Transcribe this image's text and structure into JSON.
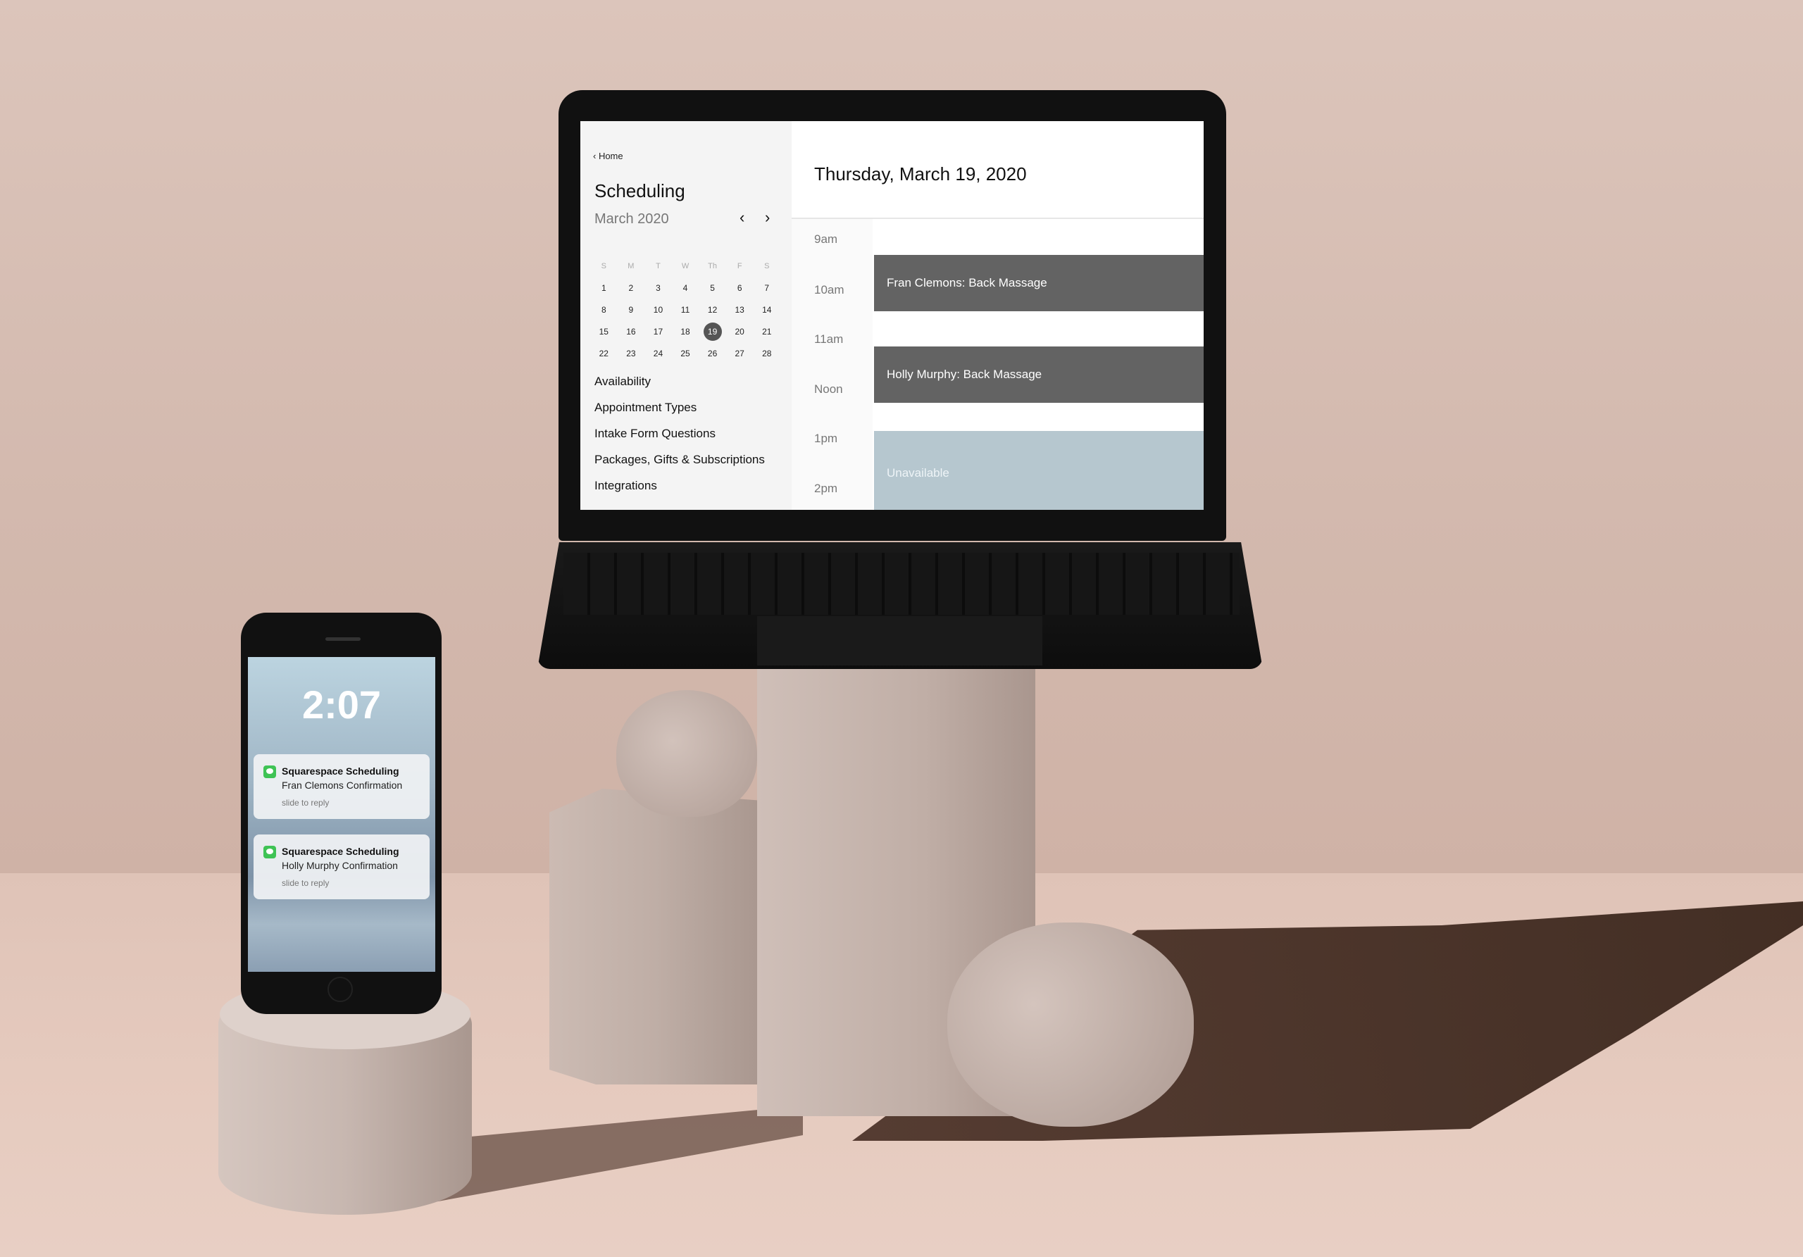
{
  "sidebar": {
    "home_link": "‹ Home",
    "title": "Scheduling",
    "month": "March 2020",
    "prev": "‹",
    "next": "›",
    "weekdays": [
      "S",
      "M",
      "T",
      "W",
      "Th",
      "F",
      "S"
    ],
    "weeks": [
      [
        "1",
        "2",
        "3",
        "4",
        "5",
        "6",
        "7"
      ],
      [
        "8",
        "9",
        "10",
        "11",
        "12",
        "13",
        "14"
      ],
      [
        "15",
        "16",
        "17",
        "18",
        "19",
        "20",
        "21"
      ],
      [
        "22",
        "23",
        "24",
        "25",
        "26",
        "27",
        "28"
      ]
    ],
    "selected_day": "19",
    "menu": [
      "Availability",
      "Appointment Types",
      "Intake Form Questions",
      "Packages, Gifts & Subscriptions",
      "Integrations"
    ]
  },
  "main": {
    "date_title": "Thursday, March 19, 2020",
    "times": [
      "9am",
      "10am",
      "11am",
      "Noon",
      "1pm",
      "2pm"
    ],
    "events": [
      "Fran Clemons: Back Massage",
      "Holly Murphy: Back Massage",
      "Unavailable"
    ]
  },
  "phone": {
    "clock": "2:07",
    "notifications": [
      {
        "app": "Squarespace Scheduling",
        "message": "Fran Clemons Confirmation",
        "hint": "slide to reply"
      },
      {
        "app": "Squarespace Scheduling",
        "message": "Holly Murphy Confirmation",
        "hint": "slide to reply"
      }
    ]
  },
  "colors": {
    "event": "#636363",
    "unavailable": "#b6c7cf",
    "selected_day": "#555555",
    "notif_icon": "#3fc355"
  }
}
